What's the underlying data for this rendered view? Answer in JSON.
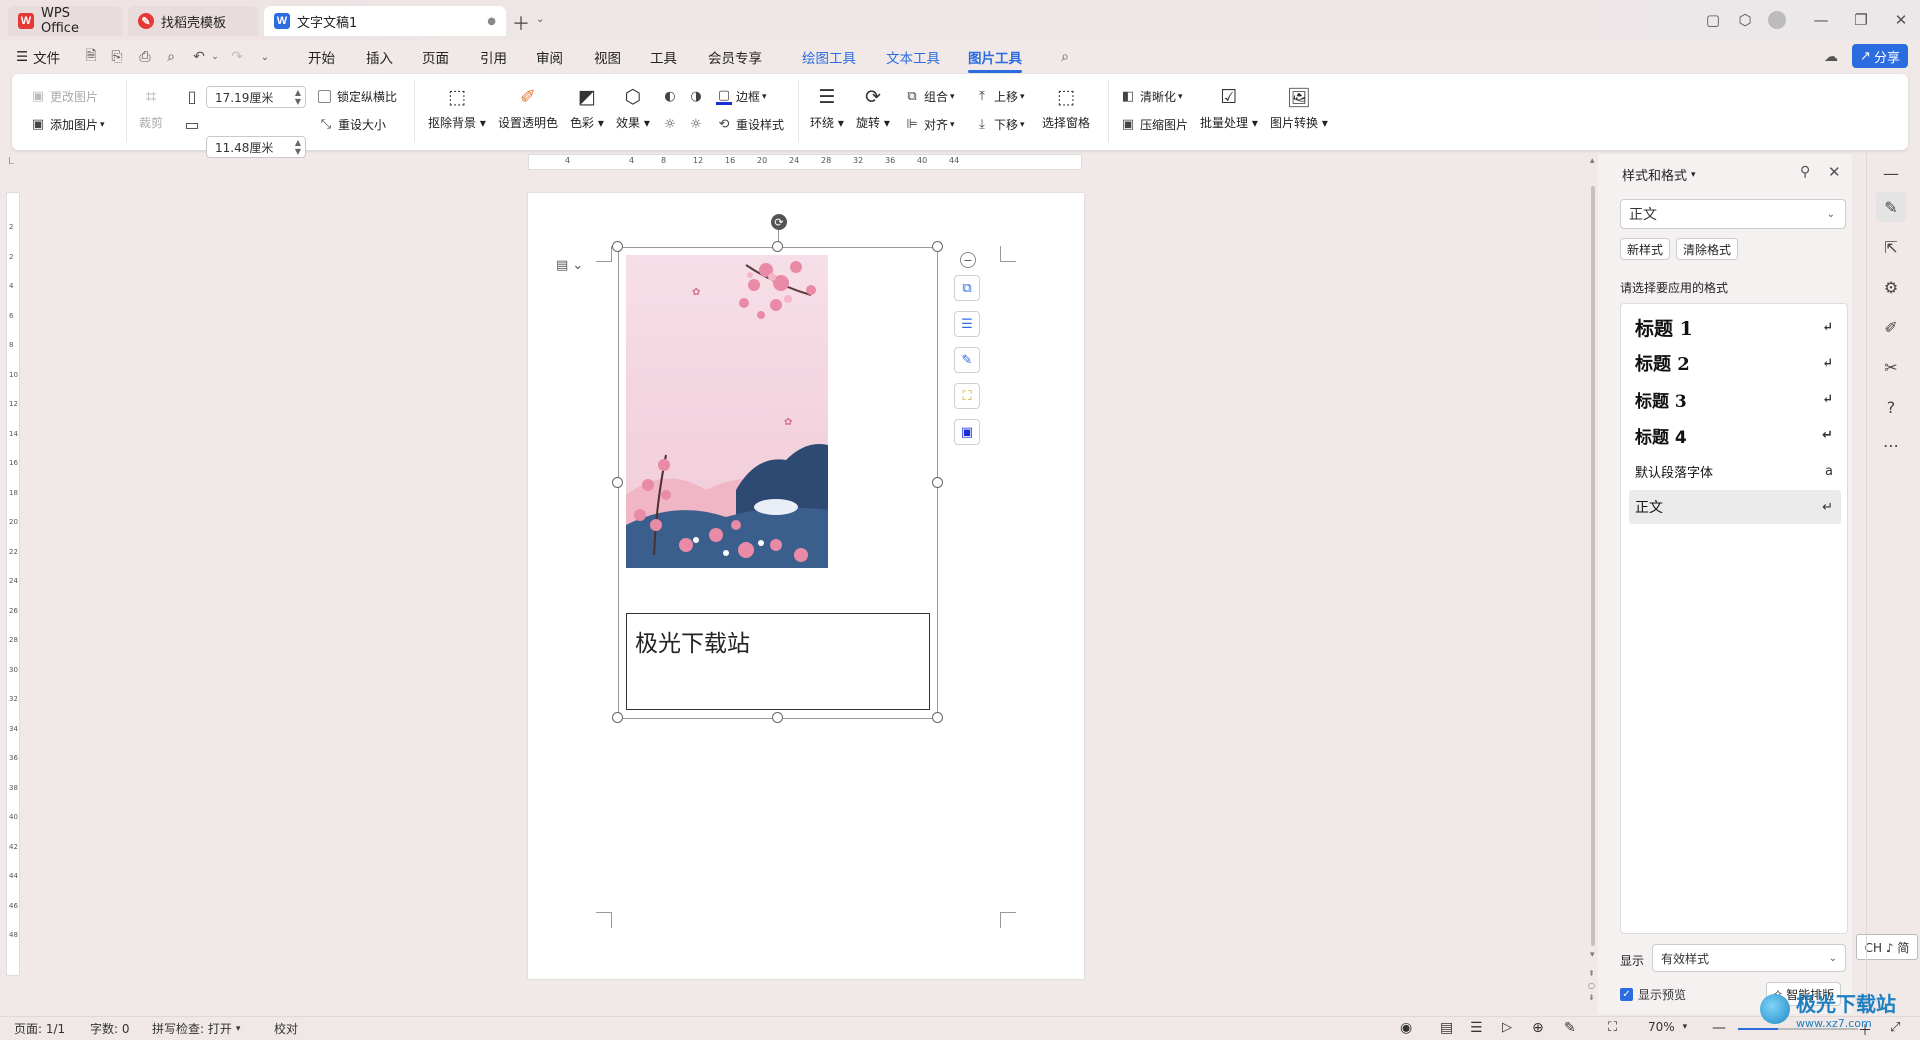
{
  "tabs": [
    {
      "label": "WPS Office"
    },
    {
      "label": "找稻壳模板"
    },
    {
      "label": "文字文稿1"
    }
  ],
  "menu": {
    "file": "文件",
    "items": [
      "开始",
      "插入",
      "页面",
      "引用",
      "审阅",
      "视图",
      "工具",
      "会员专享",
      "绘图工具",
      "文本工具",
      "图片工具"
    ],
    "share": "分享"
  },
  "ribbon": {
    "change_image": "更改图片",
    "add_image": "添加图片",
    "crop": "裁剪",
    "width": "17.19厘米",
    "height": "11.48厘米",
    "lock_ratio": "锁定纵横比",
    "reset_size": "重设大小",
    "remove_bg": "抠除背景",
    "set_transparent": "设置透明色",
    "color": "色彩",
    "effects": "效果",
    "border": "边框",
    "reset_style": "重设样式",
    "wrap": "环绕",
    "rotate": "旋转",
    "group": "组合",
    "align": "对齐",
    "move_up": "上移",
    "move_down": "下移",
    "selection_pane": "选择窗格",
    "sharpen": "清晰化",
    "compress": "压缩图片",
    "batch": "批量处理",
    "convert": "图片转换"
  },
  "ruler": {
    "h_ticks": [
      "4",
      "4",
      "8",
      "12",
      "16",
      "20",
      "24",
      "28",
      "32",
      "36",
      "40",
      "44"
    ],
    "v_ticks": [
      "2",
      "2",
      "4",
      "6",
      "8",
      "10",
      "12",
      "14",
      "16",
      "18",
      "20",
      "22",
      "24",
      "26",
      "28",
      "30",
      "32",
      "34",
      "36",
      "38",
      "40",
      "42",
      "44",
      "46",
      "48"
    ]
  },
  "document": {
    "caption": "极光下载站"
  },
  "panel": {
    "title": "样式和格式",
    "current_style": "正文",
    "new_style": "新样式",
    "clear_format": "清除格式",
    "prompt": "请选择要应用的格式",
    "styles": [
      {
        "label": "标题  1"
      },
      {
        "label": "标题  2"
      },
      {
        "label": "标题  3"
      },
      {
        "label": "标题 4"
      },
      {
        "label": "默认段落字体"
      },
      {
        "label": "正文"
      }
    ],
    "show_label": "显示",
    "show_value": "有效样式",
    "preview_label": "显示预览",
    "smart_layout": "智能排版",
    "ime": "CH ♪ 简"
  },
  "status": {
    "page": "页面: 1/1",
    "words": "字数: 0",
    "spell": "拼写检查: 打开",
    "proof": "校对",
    "zoom": "70%"
  },
  "watermark": "极光下载站",
  "watermark_url": "www.xz7.com",
  "colors": {
    "accent": "#2b6de0",
    "wps_red": "#e53935",
    "pink": "#f4d3de"
  }
}
